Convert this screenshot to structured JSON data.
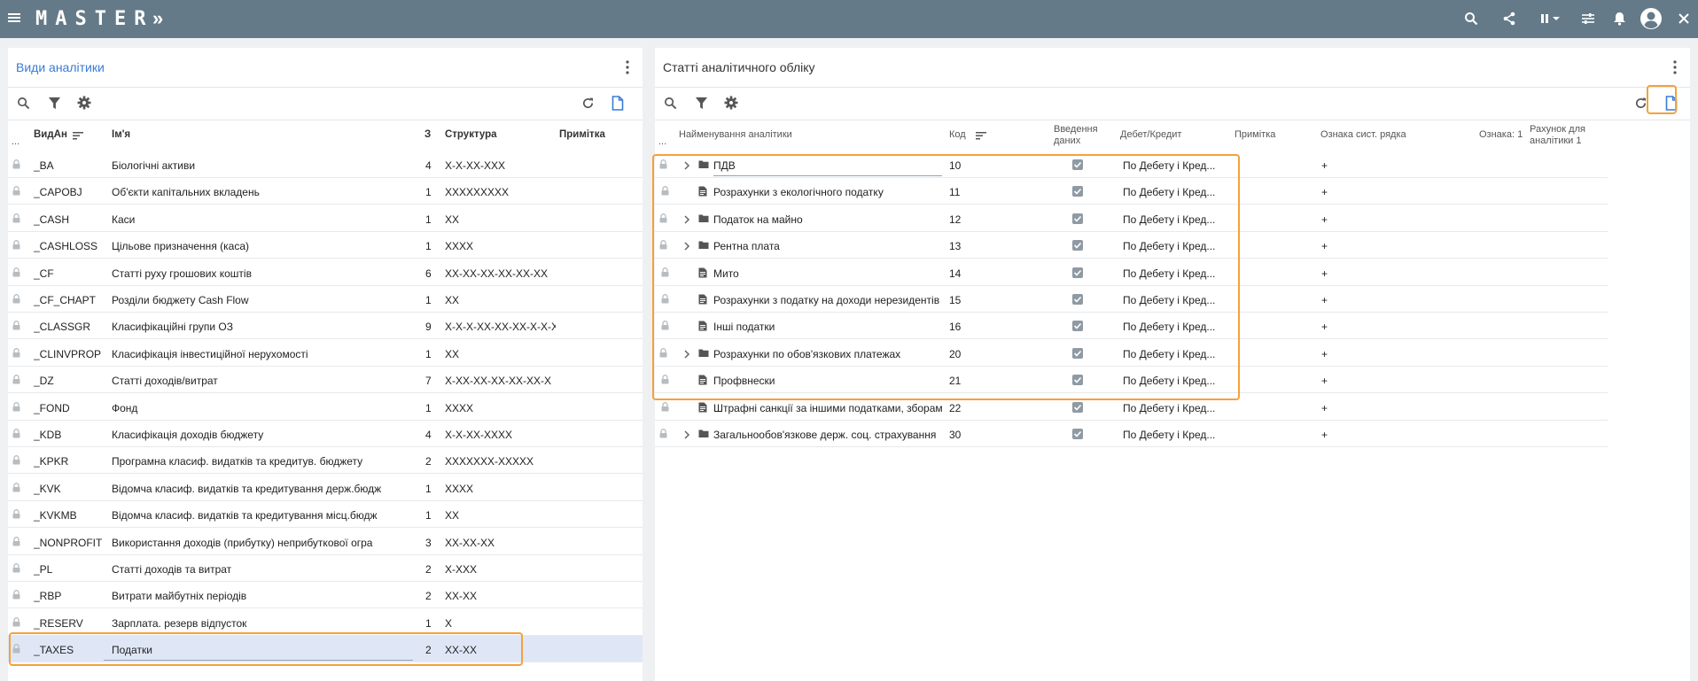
{
  "app": {
    "logo": "MASTER",
    "logo_arrow": "»"
  },
  "colors": {
    "topbar": "#647a88",
    "accent": "#3a7bd5",
    "highlight": "#f5a13a",
    "selected_row": "#dfe7f7"
  },
  "topbar_icons": [
    "menu-icon",
    "search-icon",
    "share-icon",
    "pause-icon",
    "chevron-down-icon",
    "tune-icon",
    "bell-icon",
    "account-icon",
    "close-icon"
  ],
  "left_panel": {
    "title": "Види аналітики",
    "columns": {
      "code": "ВидАн",
      "name": "Ім'я",
      "z": "З",
      "structure": "Структура",
      "note": "Примітка"
    },
    "dots": "...",
    "rows": [
      {
        "code": "_BA",
        "name": "Біологічні активи",
        "z": "4",
        "structure": "X-X-XX-XXX"
      },
      {
        "code": "_CAPOBJ",
        "name": "Об'єкти капітальних вкладень",
        "z": "1",
        "structure": "XXXXXXXXX"
      },
      {
        "code": "_CASH",
        "name": "Каси",
        "z": "1",
        "structure": "XX"
      },
      {
        "code": "_CASHLOSS",
        "name": "Цільове призначення (каса)",
        "z": "1",
        "structure": "XXXX"
      },
      {
        "code": "_CF",
        "name": "Статті руху грошових коштів",
        "z": "6",
        "structure": "XX-XX-XX-XX-XX-XX"
      },
      {
        "code": "_CF_CHAPT",
        "name": "Розділи бюджету Cash Flow",
        "z": "1",
        "structure": "XX"
      },
      {
        "code": "_CLASSGR",
        "name": "Класифікаційні групи ОЗ",
        "z": "9",
        "structure": "X-X-X-XX-XX-XX-X-X-X"
      },
      {
        "code": "_CLINVPROP",
        "name": "Класифікація інвестиційної нерухомості",
        "z": "1",
        "structure": "XX"
      },
      {
        "code": "_DZ",
        "name": "Статті доходів/витрат",
        "z": "7",
        "structure": "X-XX-XX-XX-XX-XX-X"
      },
      {
        "code": "_FOND",
        "name": "Фонд",
        "z": "1",
        "structure": "XXXX"
      },
      {
        "code": "_KDB",
        "name": "Класифікація доходів бюджету",
        "z": "4",
        "structure": "X-X-XX-XXXX"
      },
      {
        "code": "_KPKR",
        "name": "Програмна класиф. видатків та кредитув. бюджету",
        "z": "2",
        "structure": "XXXXXXX-XXXXX"
      },
      {
        "code": "_KVK",
        "name": "Відомча класиф. видатків та кредитування держ.бюдж",
        "z": "1",
        "structure": "XXXX"
      },
      {
        "code": "_KVKMB",
        "name": "Відомча класиф. видатків та кредитування місц.бюдж",
        "z": "1",
        "structure": "XX"
      },
      {
        "code": "_NONPROFIT",
        "name": "Використання доходів (прибутку) неприбуткової огра",
        "z": "3",
        "structure": "XX-XX-XX"
      },
      {
        "code": "_PL",
        "name": "Статті доходів та витрат",
        "z": "2",
        "structure": "X-XXX"
      },
      {
        "code": "_RBP",
        "name": "Витрати майбутніх періодів",
        "z": "2",
        "structure": "XX-XX"
      },
      {
        "code": "_RESERV",
        "name": "Зарплата. резерв відпусток",
        "z": "1",
        "structure": "X"
      },
      {
        "code": "_TAXES",
        "name": "Податки",
        "z": "2",
        "structure": "XX-XX",
        "selected": true
      }
    ]
  },
  "right_panel": {
    "title": "Статті аналітичного обліку",
    "columns": {
      "name": "Найменування аналітики",
      "code": "Код",
      "entry": "Введення даних",
      "debit_credit": "Дебет/Кредит",
      "note": "Примітка",
      "sys_flag": "Ознака сист. рядка",
      "flag1": "Ознака: 1",
      "account": "Рахунок для аналітики 1"
    },
    "dots": "...",
    "rows": [
      {
        "expandable": true,
        "type": "folder",
        "name": "ПДВ",
        "code": "10",
        "checked": true,
        "dc": "По Дебету і Кред...",
        "sys": "+"
      },
      {
        "expandable": false,
        "type": "doc",
        "name": "Розрахунки з екологічного податку",
        "code": "11",
        "checked": true,
        "dc": "По Дебету і Кред...",
        "sys": "+"
      },
      {
        "expandable": true,
        "type": "folder",
        "name": "Податок на майно",
        "code": "12",
        "checked": true,
        "dc": "По Дебету і Кред...",
        "sys": "+"
      },
      {
        "expandable": true,
        "type": "folder",
        "name": "Рентна плата",
        "code": "13",
        "checked": true,
        "dc": "По Дебету і Кред...",
        "sys": "+"
      },
      {
        "expandable": false,
        "type": "doc",
        "name": "Мито",
        "code": "14",
        "checked": true,
        "dc": "По Дебету і Кред...",
        "sys": "+"
      },
      {
        "expandable": false,
        "type": "doc",
        "name": "Розрахунки з податку на доходи нерезидентів",
        "code": "15",
        "checked": true,
        "dc": "По Дебету і Кред...",
        "sys": "+"
      },
      {
        "expandable": false,
        "type": "doc",
        "name": "Інші податки",
        "code": "16",
        "checked": true,
        "dc": "По Дебету і Кред...",
        "sys": "+"
      },
      {
        "expandable": true,
        "type": "folder",
        "name": "Розрахунки по обов'язкових платежах",
        "code": "20",
        "checked": true,
        "dc": "По Дебету і Кред...",
        "sys": "+"
      },
      {
        "expandable": false,
        "type": "doc",
        "name": "Профвнески",
        "code": "21",
        "checked": true,
        "dc": "По Дебету і Кред...",
        "sys": "+"
      },
      {
        "expandable": false,
        "type": "doc",
        "name": "Штрафні санкції за іншими податками, зборами",
        "code": "22",
        "checked": true,
        "dc": "По Дебету і Кред...",
        "sys": "+"
      },
      {
        "expandable": true,
        "type": "folder",
        "name": "Загальнообов'язкове держ. соц. страхування",
        "code": "30",
        "checked": true,
        "dc": "По Дебету і Кред...",
        "sys": "+"
      }
    ]
  }
}
